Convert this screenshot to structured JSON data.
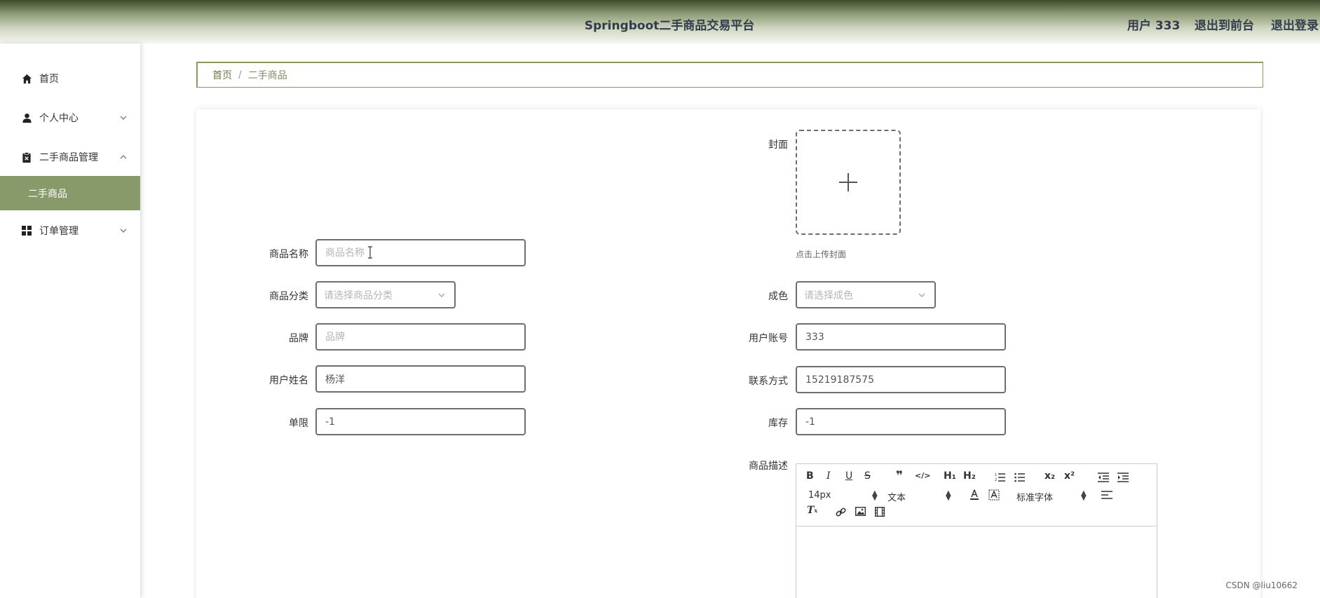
{
  "header": {
    "title": "Springboot二手商品交易平台",
    "user": "用户 333",
    "to_front": "退出到前台",
    "logout": "退出登录"
  },
  "sidebar": {
    "items": [
      {
        "label": "首页",
        "icon": "home-icon"
      },
      {
        "label": "个人中心",
        "icon": "user-icon",
        "expand": "chevron-down"
      },
      {
        "label": "二手商品管理",
        "icon": "clipboard-icon",
        "expand": "chevron-up"
      },
      {
        "label": "订单管理",
        "icon": "grid-icon",
        "expand": "chevron-down"
      }
    ],
    "active_sub": "二手商品"
  },
  "breadcrumb": {
    "home": "首页",
    "sep": "/",
    "current": "二手商品"
  },
  "form": {
    "cover_label": "封面",
    "cover_hint": "点击上传封面",
    "name_label": "商品名称",
    "name_placeholder": "商品名称",
    "category_label": "商品分类",
    "category_placeholder": "请选择商品分类",
    "condition_label": "成色",
    "condition_placeholder": "请选择成色",
    "brand_label": "品牌",
    "brand_placeholder": "品牌",
    "account_label": "用户账号",
    "account_value": "333",
    "username_label": "用户姓名",
    "username_value": "杨洋",
    "contact_label": "联系方式",
    "contact_value": "15219187575",
    "limit_label": "单限",
    "limit_value": "-1",
    "stock_label": "库存",
    "stock_value": "-1",
    "desc_label": "商品描述"
  },
  "editor": {
    "font_size": "14px",
    "paragraph": "文本",
    "font_family": "标准字体",
    "buttons": [
      "B",
      "I",
      "U",
      "S",
      "quote",
      "code",
      "H1",
      "H2",
      "ol",
      "ul",
      "sub",
      "sup",
      "outdent",
      "indent",
      "align",
      "clean",
      "link",
      "image",
      "video"
    ]
  },
  "watermark": "CSDN @liu10662",
  "colors": {
    "accent": "#899a6a",
    "header_dark": "#3f4a2a"
  }
}
